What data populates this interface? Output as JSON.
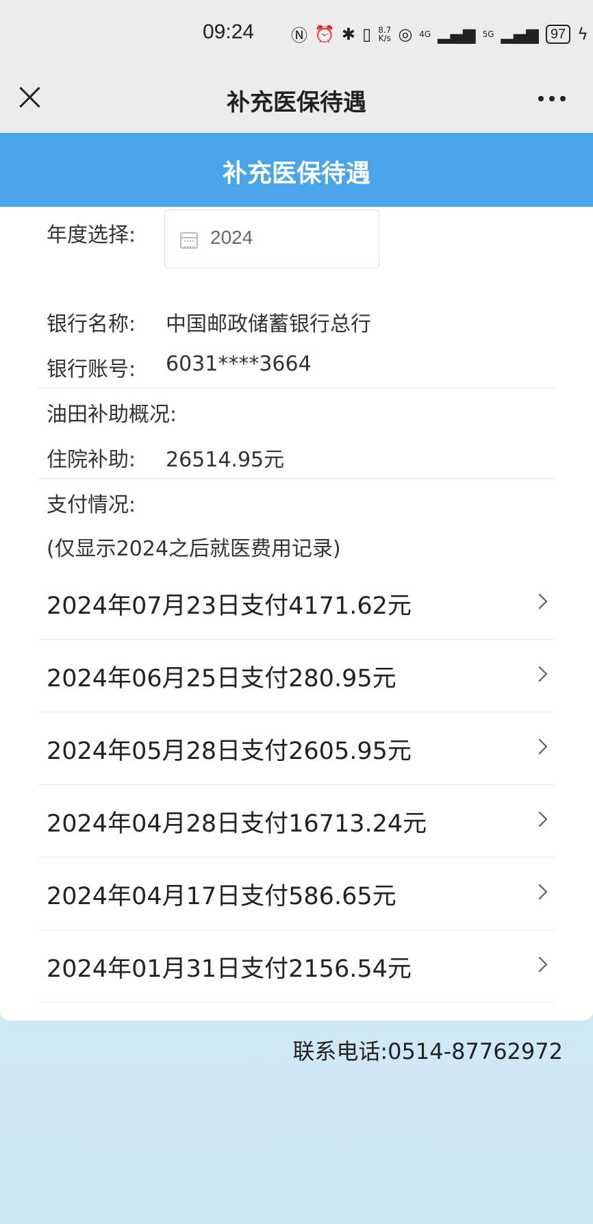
{
  "status_bar": {
    "time": "09:24",
    "net_speed_top": "8.7",
    "net_speed_bottom": "K/s",
    "signal_4g": "4G",
    "signal_5g": "5G",
    "battery": "97"
  },
  "nav": {
    "title": "补充医保待遇"
  },
  "banner": {
    "title": "补充医保待遇"
  },
  "form": {
    "year_label": "年度选择:",
    "year_value": "2024",
    "bank_name_label": "银行名称:",
    "bank_name": "中国邮政储蓄银行总行",
    "account_label": "银行账号:",
    "account": "6031****3664"
  },
  "subsidy": {
    "title": "油田补助概况:",
    "hospital_label": "住院补助:",
    "hospital_amount": "26514.95元"
  },
  "payment": {
    "title": "支付情况:",
    "note": "(仅显示2024之后就医费用记录)",
    "items": [
      {
        "text": "2024年07月23日支付4171.62元"
      },
      {
        "text": "2024年06月25日支付280.95元"
      },
      {
        "text": "2024年05月28日支付2605.95元"
      },
      {
        "text": "2024年04月28日支付16713.24元"
      },
      {
        "text": "2024年04月17日支付586.65元"
      },
      {
        "text": "2024年01月31日支付2156.54元"
      }
    ]
  },
  "footer": {
    "contact": "联系电话:0514-87762972"
  },
  "colors": {
    "banner": "#4aa4ea",
    "page_bg": "#d6ecf7"
  }
}
